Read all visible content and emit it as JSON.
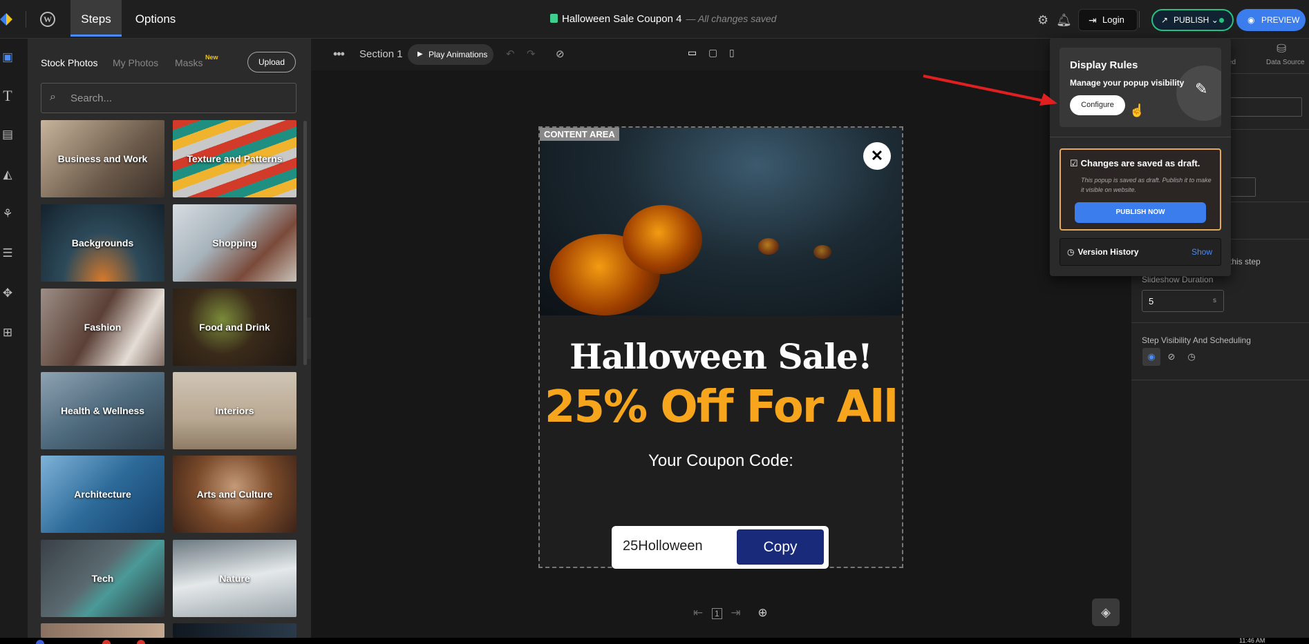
{
  "topbar": {
    "tab_steps": "Steps",
    "tab_options": "Options",
    "doc_title": "Halloween Sale Coupon 4",
    "save_status": "— All changes saved",
    "login_label": "Login",
    "publish_label": "PUBLISH",
    "preview_label": "PREVIEW",
    "accent_color": "#3b7ded",
    "publish_color": "#26c281"
  },
  "rail": {
    "icons": [
      "image-icon",
      "text-icon",
      "media-icon",
      "shapes-icon",
      "elements-icon",
      "form-icon",
      "move-icon",
      "add-icon"
    ]
  },
  "media": {
    "tabs": [
      "Stock Photos",
      "My Photos",
      "Masks"
    ],
    "new_badge": "New",
    "upload_label": "Upload",
    "search_placeholder": "Search...",
    "categories": [
      "Business and Work",
      "Texture and Patterns",
      "Backgrounds",
      "Shopping",
      "Fashion",
      "Food and Drink",
      "Health & Wellness",
      "Interiors",
      "Architecture",
      "Arts and Culture",
      "Tech",
      "Nature"
    ]
  },
  "canvas": {
    "section_label": "Section 1",
    "play_label": "Play Animations",
    "content_area_label": "CONTENT AREA",
    "headline": "Halloween Sale!",
    "offer": "25% Off For All",
    "code_label": "Your Coupon Code:",
    "coupon_code": "25Holloween",
    "copy_label": "Copy",
    "offer_color": "#f6a51d",
    "copy_color": "#1a2a7a",
    "step_number": "1"
  },
  "rpanel": {
    "tab_partial": "ed",
    "data_source_label": "Data Source",
    "step_text_partial": "this step",
    "slideshow_label": "Slideshow Duration",
    "slideshow_value": "5",
    "slideshow_unit": "s",
    "visibility_label": "Step Visibility And Scheduling"
  },
  "dropdown": {
    "display_rules_title": "Display Rules",
    "display_rules_sub": "Manage your popup visibility",
    "configure_label": "Configure",
    "draft_title": "Changes are saved as draft.",
    "draft_desc": "This popup is saved as draft. Publish it to make it visible on website.",
    "publish_now_label": "PUBLISH NOW",
    "version_label": "Version History",
    "show_label": "Show"
  },
  "taskbar": {
    "time": "11:46 AM"
  }
}
